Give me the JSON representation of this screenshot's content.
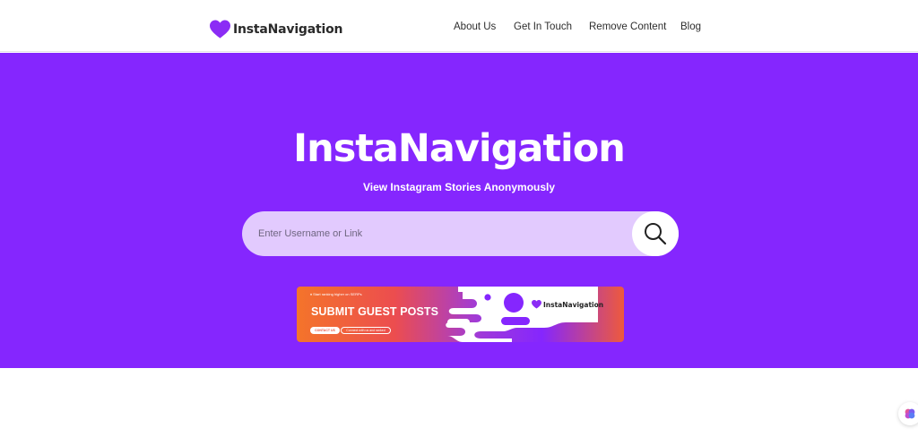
{
  "header": {
    "brand_name": "InstaNavigation",
    "brand_icon": "heart-icon",
    "nav": [
      {
        "label": "About Us"
      },
      {
        "label": "Get In Touch"
      },
      {
        "label": "Remove Content"
      },
      {
        "label": "Blog"
      }
    ]
  },
  "hero": {
    "title": "InstaNavigation",
    "subtitle": "View Instagram Stories Anonymously",
    "search": {
      "placeholder": "Enter Username or Link",
      "value": "",
      "button_icon": "search-icon"
    }
  },
  "banner": {
    "kicker": "♦ Start ranking higher on SERPs",
    "headline": "SUBMIT GUEST POSTS",
    "primary_pill": "CONTACT US",
    "secondary_pill": "Connect with us and ranked",
    "brand_name": "InstaNavigation"
  },
  "widget": {
    "icon": "assistant-brain-icon"
  },
  "colors": {
    "brand_purple": "#8526fe",
    "search_bg": "#e2cafe",
    "heart": "#8b2cf5",
    "banner_orange": "#f4742a",
    "banner_red": "#ec4d4f"
  }
}
